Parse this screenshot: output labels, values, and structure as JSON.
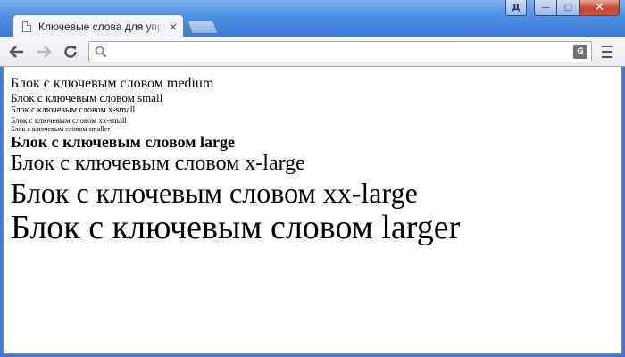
{
  "window": {
    "user_button_label": "Д",
    "minimize_label": "—",
    "maximize_label": "□",
    "close_label": "✕"
  },
  "tab": {
    "title": "Ключевые слова для управления размером",
    "close_label": "×"
  },
  "toolbar": {
    "address_value": "",
    "translate_label": "G"
  },
  "page": {
    "lines": [
      "Блок с ключевым словом medium",
      "Блок с ключевым словом small",
      "Блок с ключевым словом x-small",
      "Блок с ключевым словом xx-small",
      "Блок с ключевым словом smaller",
      "Блок с ключевым словом large",
      "Блок с ключевым словом x-large",
      "Блок с ключевым словом xx-large",
      "Блок с ключевым словом larger"
    ]
  },
  "colors": {
    "titlebar": "#3d7cd8",
    "close_button": "#c8442b",
    "page_background": "#ffffff"
  },
  "icons": {
    "back": "arrow-left-icon",
    "forward": "arrow-right-icon",
    "reload": "reload-icon",
    "search": "search-icon",
    "translate": "translate-icon",
    "menu": "menu-icon",
    "page": "page-icon"
  }
}
